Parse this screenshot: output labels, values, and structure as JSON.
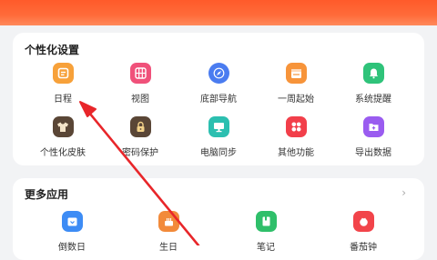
{
  "section1": {
    "title": "个性化设置",
    "items": [
      {
        "label": "日程",
        "icon": "schedule-icon",
        "color": "#f7a13a"
      },
      {
        "label": "视图",
        "icon": "grid-view-icon",
        "color": "#f0517a"
      },
      {
        "label": "底部导航",
        "icon": "compass-icon",
        "color": "#4a7cf0"
      },
      {
        "label": "一周起始",
        "icon": "calendar-week-icon",
        "color": "#f7943a"
      },
      {
        "label": "系统提醒",
        "icon": "bell-icon",
        "color": "#2fc37a"
      },
      {
        "label": "个性化皮肤",
        "icon": "tshirt-icon",
        "color": "#5a4636"
      },
      {
        "label": "密码保护",
        "icon": "lock-icon",
        "color": "#5a4636"
      },
      {
        "label": "电脑同步",
        "icon": "monitor-icon",
        "color": "#2cbfb0"
      },
      {
        "label": "其他功能",
        "icon": "apps-icon",
        "color": "#f23f4a"
      },
      {
        "label": "导出数据",
        "icon": "export-icon",
        "color": "#9a5cf0"
      }
    ]
  },
  "section2": {
    "title": "更多应用",
    "chevron": "›",
    "items": [
      {
        "label": "倒数日",
        "icon": "countdown-icon",
        "color": "#3d8cf5"
      },
      {
        "label": "生日",
        "icon": "cake-icon",
        "color": "#f28a3a"
      },
      {
        "label": "笔记",
        "icon": "notebook-icon",
        "color": "#2fbf6a"
      },
      {
        "label": "番茄钟",
        "icon": "tomato-icon",
        "color": "#f2444a"
      }
    ]
  },
  "colors": {
    "banner": "#ff5a2a",
    "arrow": "#e8262a",
    "background": "#f2f3f5"
  }
}
